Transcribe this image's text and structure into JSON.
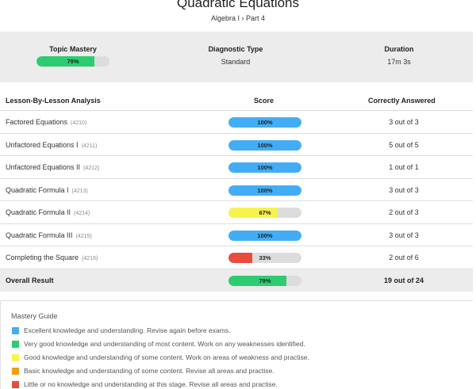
{
  "header": {
    "title": "Quadratic Equations",
    "subtitle": "Algebra I › Part 4"
  },
  "summary": {
    "mastery_label": "Topic Mastery",
    "mastery_value": "79%",
    "mastery_fraction": 0.79,
    "diagnostic_label": "Diagnostic Type",
    "diagnostic_value": "Standard",
    "duration_label": "Duration",
    "duration_value": "17m 3s"
  },
  "table": {
    "headers": {
      "lesson": "Lesson-By-Lesson Analysis",
      "score": "Score",
      "correct": "Correctly Answered"
    },
    "rows": [
      {
        "name": "Factored Equations",
        "code": "(4210)",
        "score": "100%",
        "fraction": 1.0,
        "color": "#42adf5",
        "correct": "3 out of 3"
      },
      {
        "name": "Unfactored Equations I",
        "code": "(4211)",
        "score": "100%",
        "fraction": 1.0,
        "color": "#42adf5",
        "correct": "5 out of 5"
      },
      {
        "name": "Unfactored Equations II",
        "code": "(4212)",
        "score": "100%",
        "fraction": 1.0,
        "color": "#42adf5",
        "correct": "1 out of 1"
      },
      {
        "name": "Quadratic Formula I",
        "code": "(4213)",
        "score": "100%",
        "fraction": 1.0,
        "color": "#42adf5",
        "correct": "3 out of 3"
      },
      {
        "name": "Quadratic Formula II",
        "code": "(4214)",
        "score": "67%",
        "fraction": 0.67,
        "color": "#f7f34d",
        "correct": "2 out of 3"
      },
      {
        "name": "Quadratic Formula III",
        "code": "(4215)",
        "score": "100%",
        "fraction": 1.0,
        "color": "#42adf5",
        "correct": "3 out of 3"
      },
      {
        "name": "Completing the Square",
        "code": "(4216)",
        "score": "33%",
        "fraction": 0.33,
        "color": "#e84c3d",
        "correct": "2 out of 6"
      }
    ],
    "overall": {
      "name": "Overall Result",
      "score": "79%",
      "fraction": 0.79,
      "color": "#2ecc71",
      "correct": "19 out of 24"
    }
  },
  "guide": {
    "title": "Mastery Guide",
    "items": [
      {
        "color": "#42adf5",
        "text": "Excellent knowledge and understanding. Revise again before exams."
      },
      {
        "color": "#2ecc71",
        "text": "Very good knowledge and understanding of most content. Work on any weaknesses identified."
      },
      {
        "color": "#f7f34d",
        "text": "Good knowledge and understanding of some content. Work on areas of weakness and practise."
      },
      {
        "color": "#f39c12",
        "text": "Basic knowledge and understanding of some content. Revise all areas and practise."
      },
      {
        "color": "#e84c3d",
        "text": "Little or no knowledge and understanding at this stage. Revise all areas and practise."
      }
    ]
  }
}
